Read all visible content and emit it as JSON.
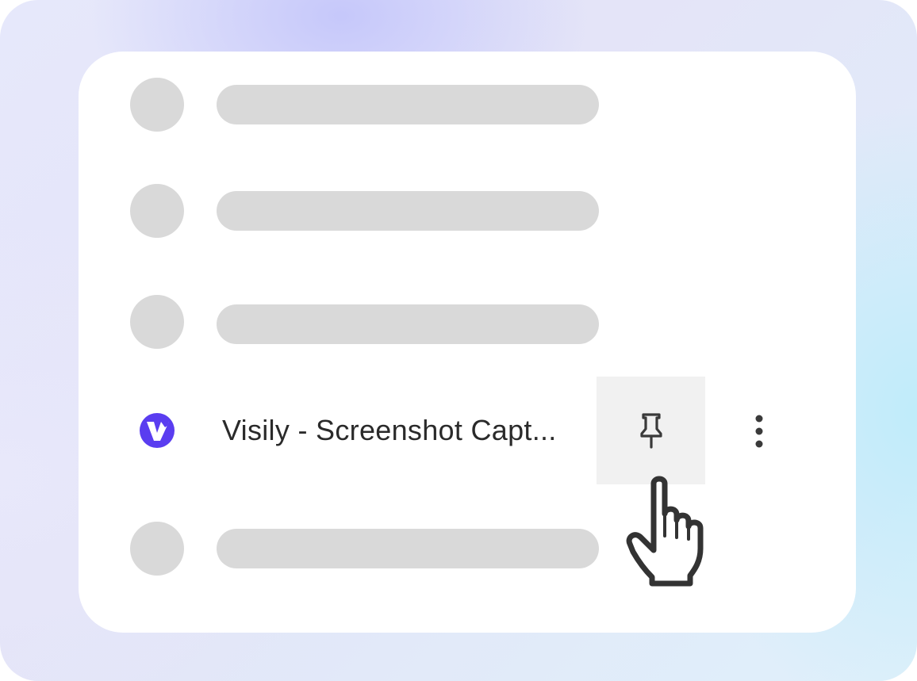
{
  "extensions_menu": {
    "placeholder_rows": [
      {
        "kind": "placeholder"
      },
      {
        "kind": "placeholder"
      },
      {
        "kind": "placeholder"
      },
      {
        "kind": "placeholder"
      }
    ],
    "featured_extension": {
      "name": "Visily - Screenshot Capt...",
      "icon": "visily-logo-icon",
      "pin_icon": "pin-icon",
      "more_icon": "more-vertical-icon",
      "pinned": false
    }
  },
  "pointer": {
    "icon": "hand-pointer-cursor-icon"
  },
  "colors": {
    "placeholder": "#d9d9d9",
    "brand": "#5a3df0",
    "hover_bg": "#f1f1f1",
    "text": "#2a2a2a",
    "icon": "#3a3a3a"
  }
}
